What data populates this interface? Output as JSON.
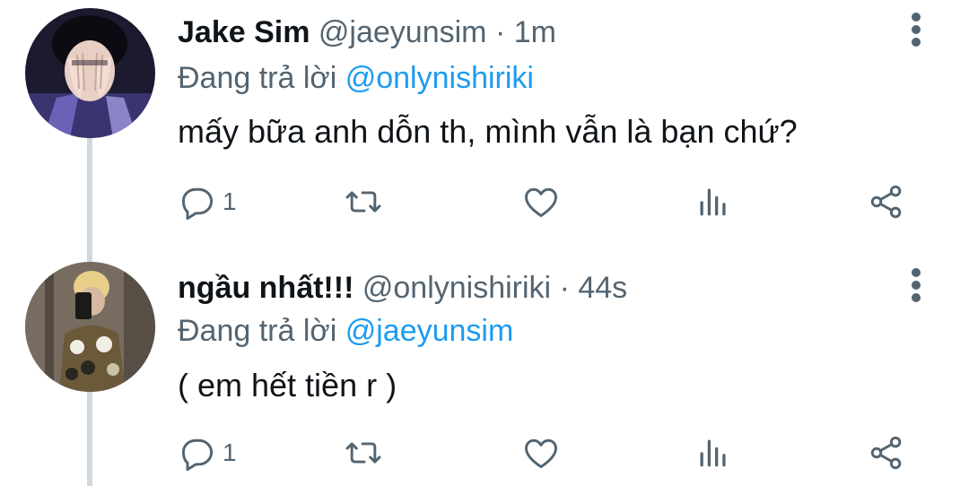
{
  "tweets": [
    {
      "name": "Jake Sim",
      "handle": "@jaeyunsim",
      "separator": "·",
      "time": "1m",
      "reply_prefix": "Đang trả lời",
      "reply_to": "@onlynishiriki",
      "text": "mấy bữa anh dỗn th, mình vẫn là bạn chứ?",
      "reply_count": "1",
      "avatar_icon": "avatar-dark-hands-face"
    },
    {
      "name": "ngầu nhất!!!",
      "handle": "@onlynishiriki",
      "separator": "·",
      "time": "44s",
      "reply_prefix": "Đang trả lời",
      "reply_to": "@jaeyunsim",
      "text": "( em hết tiền r )",
      "reply_count": "1",
      "avatar_icon": "avatar-mirror-selfie"
    }
  ],
  "colors": {
    "text_primary": "#0f1419",
    "text_secondary": "#536471",
    "link": "#1d9bf0",
    "thread_line": "#cfd9de"
  }
}
